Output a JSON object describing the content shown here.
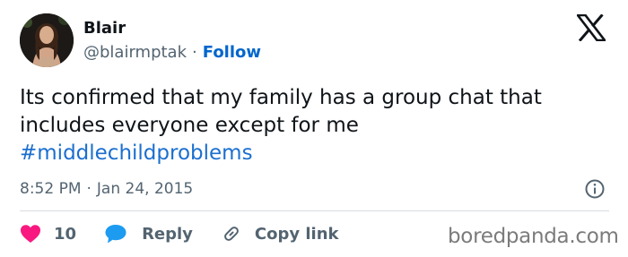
{
  "author": {
    "name": "Blair",
    "handle": "@blairmptak",
    "separator": "·",
    "follow_label": "Follow"
  },
  "tweet": {
    "line1": "Its confirmed that my family has a group chat that",
    "line2": "includes everyone except for me",
    "hashtag": "#middlechildproblems"
  },
  "meta": {
    "time": "8:52 PM",
    "separator": "·",
    "date": "Jan 24, 2015"
  },
  "actions": {
    "like_count": "10",
    "reply_label": "Reply",
    "copy_link_label": "Copy link"
  },
  "watermark": "boredpanda.com",
  "colors": {
    "text": "#0f1419",
    "secondary": "#536471",
    "link": "#1b6fcf",
    "like": "#f91880",
    "reply": "#1d9bf0"
  },
  "icons": {
    "brand": "x-logo-icon",
    "info": "info-icon",
    "like": "heart-icon",
    "reply": "speech-bubble-icon",
    "copy": "link-icon"
  }
}
